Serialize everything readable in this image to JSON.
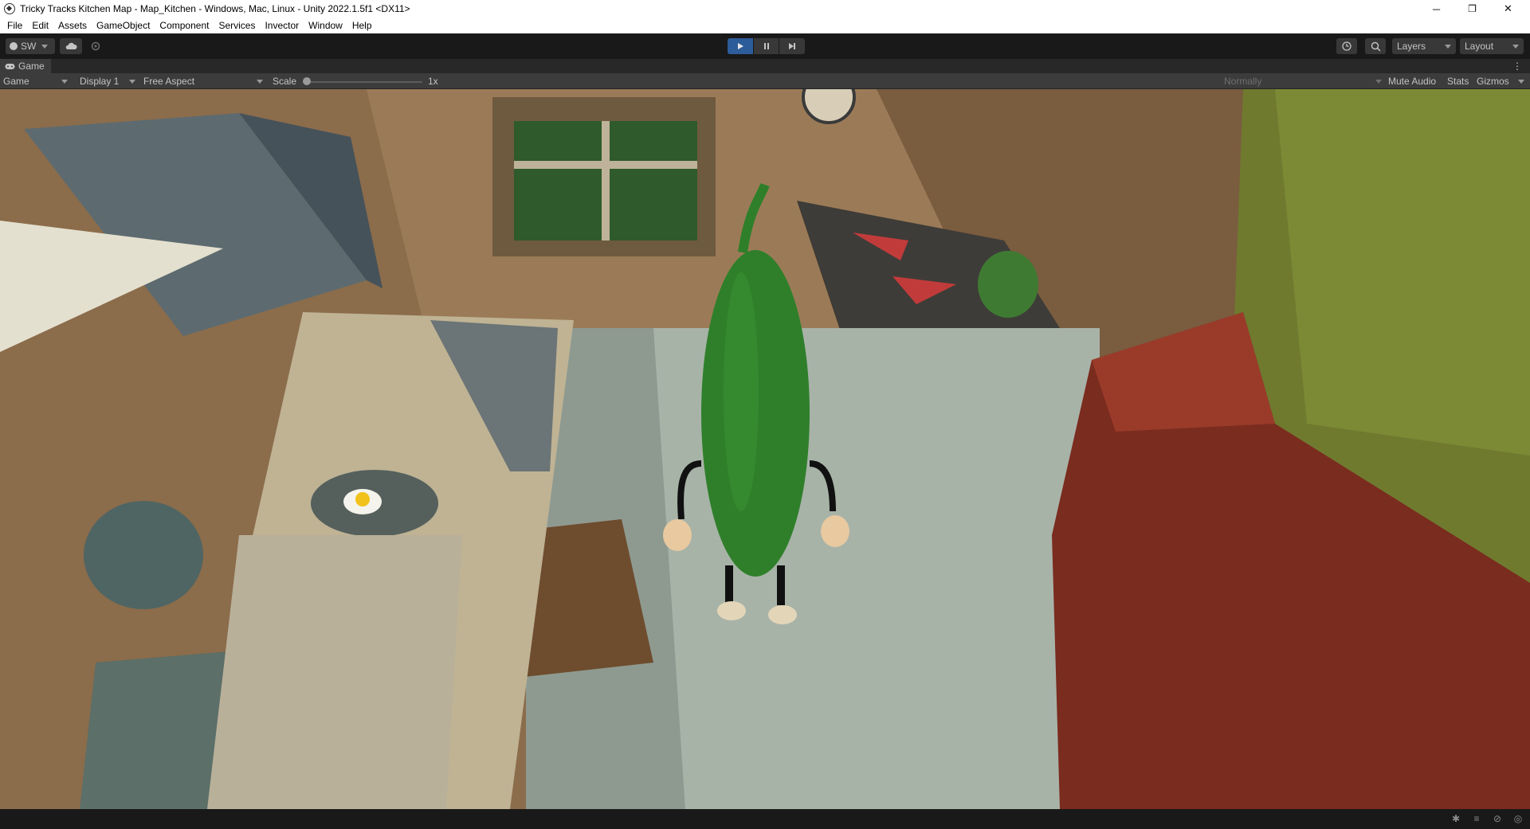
{
  "window": {
    "title": "Tricky Tracks Kitchen Map - Map_Kitchen - Windows, Mac, Linux - Unity 2022.1.5f1 <DX11>",
    "controls": {
      "minimize": "─",
      "restore": "❐",
      "close": "✕"
    }
  },
  "menu": {
    "items": [
      "File",
      "Edit",
      "Assets",
      "GameObject",
      "Component",
      "Services",
      "Invector",
      "Window",
      "Help"
    ]
  },
  "toolbar": {
    "account_label": "SW",
    "play_icon": "play-icon",
    "pause_icon": "pause-icon",
    "step_icon": "step-icon",
    "layers_label": "Layers",
    "layout_label": "Layout",
    "accent_color": "#2d5c9a"
  },
  "game_tab": {
    "label": "Game",
    "view_mode": "Game",
    "display": "Display 1",
    "aspect": "Free Aspect",
    "scale_label": "Scale",
    "scale_value": "1x",
    "scale_fraction": 0.0,
    "render_mode": "Normally",
    "mute_audio": "Mute Audio",
    "stats": "Stats",
    "gizmos": "Gizmos"
  }
}
